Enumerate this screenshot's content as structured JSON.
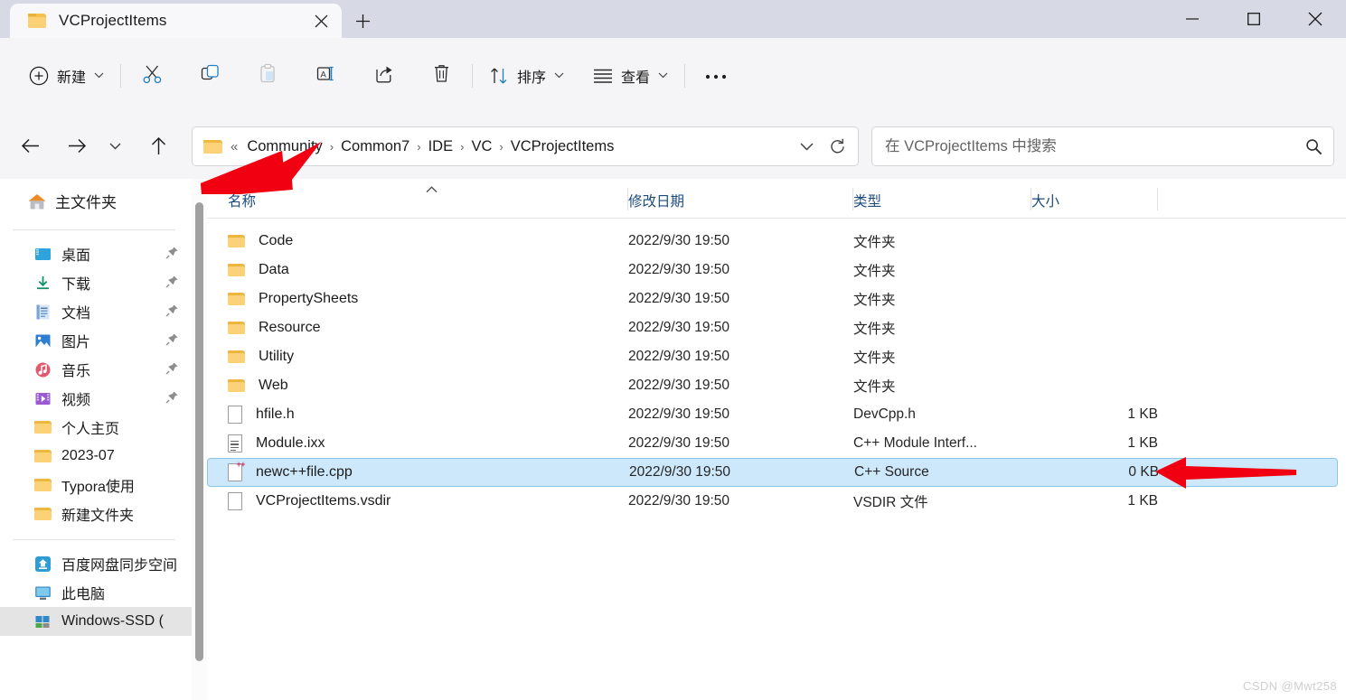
{
  "window": {
    "tab_title": "VCProjectItems",
    "tab_close_icon": "close-icon",
    "new_tab_icon": "plus-icon",
    "minimize_icon": "minimize-icon",
    "maximize_icon": "maximize-icon",
    "close_icon": "close-icon"
  },
  "toolbar": {
    "new_label": "新建",
    "cut_icon": "scissors-icon",
    "copy_icon": "copy-icon",
    "paste_icon": "paste-icon",
    "rename_icon": "rename-icon",
    "share_icon": "share-icon",
    "delete_icon": "trash-icon",
    "sort_label": "排序",
    "view_label": "查看",
    "more_label": "…"
  },
  "nav": {
    "back_icon": "arrow-left-icon",
    "forward_icon": "arrow-right-icon",
    "recent_icon": "chevron-down-icon",
    "up_icon": "arrow-up-icon",
    "overflow_chevron": "«",
    "breadcrumbs": [
      "Community",
      "Common7",
      "IDE",
      "VC",
      "VCProjectItems"
    ],
    "crumb_separator": "›",
    "dropdown_icon": "chevron-down-icon",
    "refresh_icon": "refresh-icon"
  },
  "search": {
    "placeholder": "在 VCProjectItems 中搜索",
    "icon": "search-icon"
  },
  "sidebar": {
    "home": {
      "label": "主文件夹",
      "icon": "home-icon"
    },
    "pinned": [
      {
        "label": "桌面",
        "icon": "desktop-icon",
        "color": "#2da0d8",
        "pinned": true
      },
      {
        "label": "下载",
        "icon": "download-icon",
        "color": "#1d9e7a",
        "pinned": true
      },
      {
        "label": "文档",
        "icon": "documents-icon",
        "color": "#5a8fd0",
        "pinned": true
      },
      {
        "label": "图片",
        "icon": "pictures-icon",
        "color": "#2e7fd4",
        "pinned": true
      },
      {
        "label": "音乐",
        "icon": "music-icon",
        "color": "#e05a6e",
        "pinned": true
      },
      {
        "label": "视频",
        "icon": "videos-icon",
        "color": "#9b5ad4",
        "pinned": true
      }
    ],
    "folders": [
      {
        "label": "个人主页",
        "icon": "folder-icon"
      },
      {
        "label": "2023-07",
        "icon": "folder-icon"
      },
      {
        "label": "Typora使用",
        "icon": "folder-icon"
      },
      {
        "label": "新建文件夹",
        "icon": "folder-icon"
      }
    ],
    "places": [
      {
        "label": "百度网盘同步空间",
        "icon": "baidu-netdisk-icon",
        "selected": false
      },
      {
        "label": "此电脑",
        "icon": "this-pc-icon",
        "selected": false
      },
      {
        "label": "Windows-SSD (",
        "icon": "windows-drive-icon",
        "selected": true
      }
    ]
  },
  "list": {
    "columns": [
      {
        "label": "名称",
        "key": "name"
      },
      {
        "label": "修改日期",
        "key": "date"
      },
      {
        "label": "类型",
        "key": "type"
      },
      {
        "label": "大小",
        "key": "size"
      }
    ],
    "sort_indicator": "^",
    "rows": [
      {
        "name": "Code",
        "date": "2022/9/30 19:50",
        "type": "文件夹",
        "size": "",
        "icon": "folder-icon",
        "selected": false
      },
      {
        "name": "Data",
        "date": "2022/9/30 19:50",
        "type": "文件夹",
        "size": "",
        "icon": "folder-icon",
        "selected": false
      },
      {
        "name": "PropertySheets",
        "date": "2022/9/30 19:50",
        "type": "文件夹",
        "size": "",
        "icon": "folder-icon",
        "selected": false
      },
      {
        "name": "Resource",
        "date": "2022/9/30 19:50",
        "type": "文件夹",
        "size": "",
        "icon": "folder-icon",
        "selected": false
      },
      {
        "name": "Utility",
        "date": "2022/9/30 19:50",
        "type": "文件夹",
        "size": "",
        "icon": "folder-icon",
        "selected": false
      },
      {
        "name": "Web",
        "date": "2022/9/30 19:50",
        "type": "文件夹",
        "size": "",
        "icon": "folder-icon",
        "selected": false
      },
      {
        "name": "hfile.h",
        "date": "2022/9/30 19:50",
        "type": "DevCpp.h",
        "size": "1 KB",
        "icon": "file-blank-icon",
        "selected": false
      },
      {
        "name": "Module.ixx",
        "date": "2022/9/30 19:50",
        "type": "C++ Module Interf...",
        "size": "1 KB",
        "icon": "file-text-icon",
        "selected": false
      },
      {
        "name": "newc++file.cpp",
        "date": "2022/9/30 19:50",
        "type": "C++ Source",
        "size": "0 KB",
        "icon": "file-cpp-icon",
        "selected": true
      },
      {
        "name": "VCProjectItems.vsdir",
        "date": "2022/9/30 19:50",
        "type": "VSDIR 文件",
        "size": "1 KB",
        "icon": "file-blank-icon",
        "selected": false
      }
    ]
  },
  "annotations": {
    "arrow_color": "#f00010",
    "arrow_breadcrumb": "arrow-pointing-to-breadcrumb",
    "arrow_selected_row": "arrow-pointing-to-selected-row"
  },
  "watermark": "CSDN @Mwt258",
  "colors": {
    "titlebar": "#d7d9e5",
    "toolbar": "#f5f5f7",
    "selection": "#cde8fa",
    "selection_border": "#8cc5ea",
    "column_header_text": "#1b4b7d",
    "folder_yellow": "#fbd278"
  }
}
